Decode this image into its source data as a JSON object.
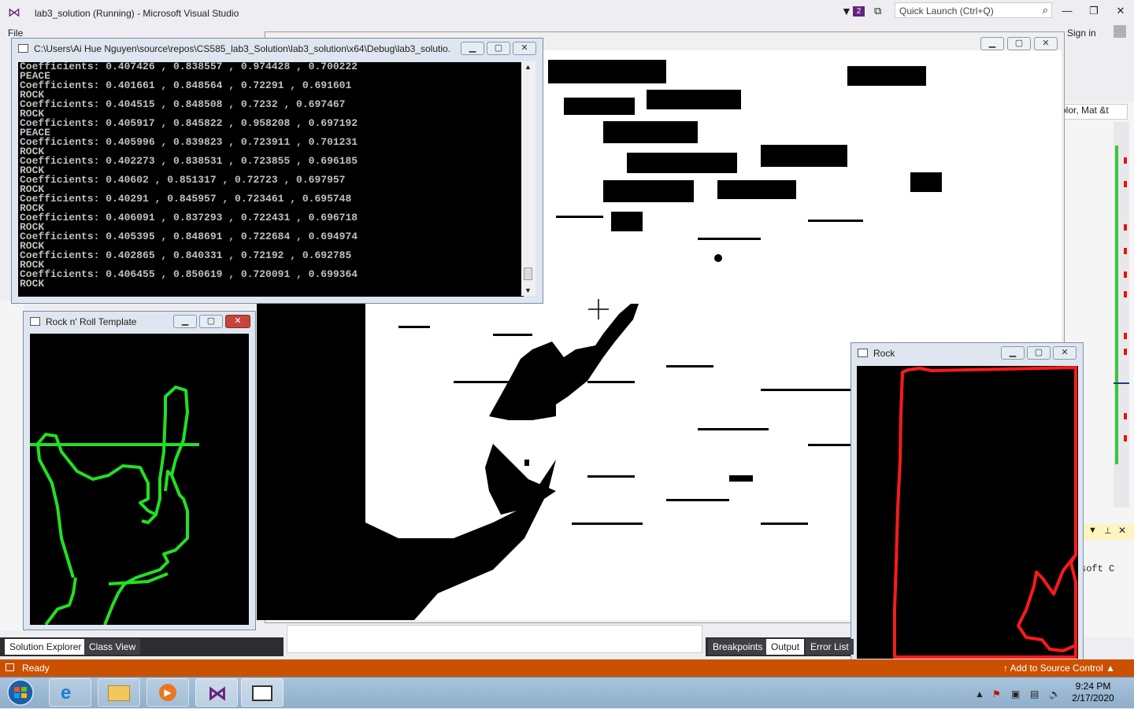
{
  "vs": {
    "title": "lab3_solution (Running) - Microsoft Visual Studio",
    "notification_count": "2",
    "quick_launch_placeholder": "Quick Launch (Ctrl+Q)",
    "sign_in": "Sign in",
    "menu_file": "File",
    "right_combo": "olor, Mat &t",
    "right_code": "soft C",
    "status": "Ready",
    "source_control": "Add to Source Control",
    "left_tabs": [
      "Solution Explorer",
      "Class View"
    ],
    "bottom_tabs": [
      "Breakpoints",
      "Output",
      "Error List"
    ]
  },
  "console": {
    "title": "C:\\Users\\Ai Hue Nguyen\\source\\repos\\CS585_lab3_Solution\\lab3_solution\\x64\\Debug\\lab3_solutio...",
    "lines": [
      "Coefficients: 0.407426 , 0.838557 , 0.974428 , 0.700222",
      "PEACE",
      "Coefficients: 0.401661 , 0.848564 , 0.72291 , 0.691601",
      "ROCK",
      "Coefficients: 0.404515 , 0.848508 , 0.7232 , 0.697467",
      "ROCK",
      "Coefficients: 0.405917 , 0.845822 , 0.958208 , 0.697192",
      "PEACE",
      "Coefficients: 0.405996 , 0.839823 , 0.723911 , 0.701231",
      "ROCK",
      "Coefficients: 0.402273 , 0.838531 , 0.723855 , 0.696185",
      "ROCK",
      "Coefficients: 0.40602 , 0.851317 , 0.72723 , 0.697957",
      "ROCK",
      "Coefficients: 0.40291 , 0.845957 , 0.723461 , 0.695748",
      "ROCK",
      "Coefficients: 0.406091 , 0.837293 , 0.722431 , 0.696718",
      "ROCK",
      "Coefficients: 0.405395 , 0.848691 , 0.722684 , 0.694974",
      "ROCK",
      "Coefficients: 0.402865 , 0.840331 , 0.72192 , 0.692785",
      "ROCK",
      "Coefficients: 0.406455 , 0.850619 , 0.720091 , 0.699364",
      "ROCK"
    ]
  },
  "template_window": {
    "title": "Rock n' Roll Template"
  },
  "rock_window": {
    "title": "Rock"
  },
  "taskbar": {
    "time": "9:24 PM",
    "date": "2/17/2020"
  },
  "colors": {
    "status_bar": "#ca5100",
    "template_outline": "#22e022",
    "rock_outline": "#ff1a1a"
  }
}
